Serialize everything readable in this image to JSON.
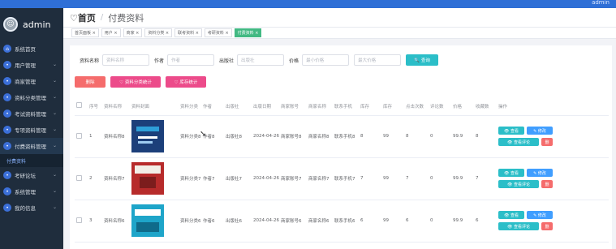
{
  "top": {
    "admin_label": "admin"
  },
  "sidebar": {
    "brand": "admin",
    "items": [
      {
        "label": "系统首页",
        "icon": "home-icon",
        "chevron": ""
      },
      {
        "label": "用户管理",
        "icon": "user-icon",
        "chevron": "⌄"
      },
      {
        "label": "商家管理",
        "icon": "shop-icon",
        "chevron": "⌄"
      },
      {
        "label": "资料分类管理",
        "icon": "category-icon",
        "chevron": "⌄"
      },
      {
        "label": "考试资料管理",
        "icon": "doc-icon",
        "chevron": "⌄"
      },
      {
        "label": "专项资料管理",
        "icon": "folder-icon",
        "chevron": "⌄"
      },
      {
        "label": "付费资料管理",
        "icon": "pay-icon",
        "chevron": "⌄"
      },
      {
        "label": "考研论坛",
        "icon": "forum-icon",
        "chevron": "⌄"
      },
      {
        "label": "系统管理",
        "icon": "settings-icon",
        "chevron": "⌄"
      },
      {
        "label": "我的信息",
        "icon": "profile-icon",
        "chevron": "⌄"
      }
    ],
    "sub_item": "付费资料"
  },
  "header": {
    "home": "♡首页",
    "sep": "/",
    "current": "付费资料"
  },
  "tags": [
    "首页面板 ×",
    "用户 ×",
    "商家 ×",
    "资料分类 ×",
    "联考资料 ×",
    "考研资料 ×",
    "付费资料 ×"
  ],
  "search": {
    "name_label": "资料名称",
    "name_ph": "资料名称",
    "author_label": "作者",
    "author_ph": "作者",
    "publisher_label": "出版社",
    "publisher_ph": "出版社",
    "price_label": "价格",
    "price_min_ph": "最小价格",
    "price_max_ph": "最大价格",
    "query_btn": "🔍 查询"
  },
  "actions": {
    "delete": "删除",
    "stat1": "♡ 资料分类统计",
    "stat2": "♡ 库存统计"
  },
  "table": {
    "headers": [
      "",
      "序号",
      "资料名称",
      "资料封面",
      "资料分类",
      "作者",
      "出版社",
      "出版日期",
      "商家账号",
      "商家名称",
      "联系手机",
      "库存",
      "库存",
      "点击次数",
      "评论数",
      "价格",
      "收藏数",
      "操作"
    ],
    "rows": [
      {
        "index": "1",
        "name": "资料名称8",
        "category": "资料分类8",
        "author": "作者8",
        "publisher": "出版社8",
        "date": "2024-04-26",
        "merchant": "商家账号8",
        "merchant_name": "商家名称8",
        "phone": "联系手机8",
        "stock": "8",
        "stock2": "99",
        "clicks": "8",
        "comments": "0",
        "price": "99.9",
        "favs": "8"
      },
      {
        "index": "2",
        "name": "资料名称7",
        "category": "资料分类7",
        "author": "作者7",
        "publisher": "出版社7",
        "date": "2024-04-26",
        "merchant": "商家账号7",
        "merchant_name": "商家名称7",
        "phone": "联系手机7",
        "stock": "7",
        "stock2": "99",
        "clicks": "7",
        "comments": "0",
        "price": "99.9",
        "favs": "7"
      },
      {
        "index": "3",
        "name": "资料名称6",
        "category": "资料分类6",
        "author": "作者6",
        "publisher": "出版社6",
        "date": "2024-04-26",
        "merchant": "商家账号6",
        "merchant_name": "商家名称6",
        "phone": "联系手机6",
        "stock": "6",
        "stock2": "99",
        "clicks": "6",
        "comments": "0",
        "price": "99.9",
        "favs": "6"
      }
    ],
    "op_view": "👁 查看",
    "op_edit": "✎ 修改",
    "op_comments": "👁 查看评论",
    "op_delete": "删"
  },
  "colors": {
    "accent": "#2f6fd6",
    "sidebar_bg": "#1f2d3d",
    "teal": "#2bbec8",
    "red": "#f56c6c",
    "pink": "#ec4b8a",
    "blue": "#409eff"
  }
}
